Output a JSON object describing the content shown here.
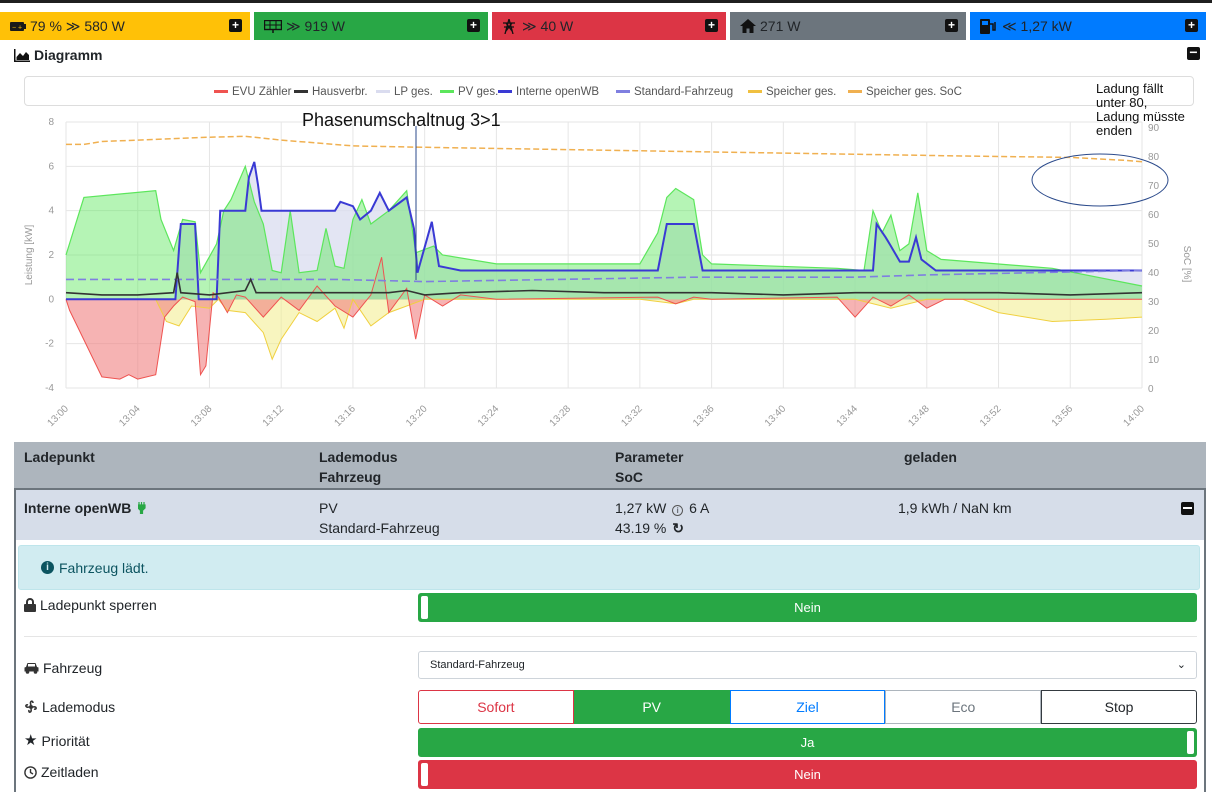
{
  "status": {
    "battery": {
      "icon": "battery-icon",
      "text": "79 % ≫ 580 W",
      "color": "#ffc107"
    },
    "pv": {
      "icon": "solar-panel-icon",
      "text": "≫ 919 W",
      "color": "#28a745"
    },
    "grid": {
      "icon": "grid-tower-icon",
      "text": "≫ 40 W",
      "color": "#dc3545"
    },
    "house": {
      "icon": "home-icon",
      "text": "271 W",
      "color": "#6c757d"
    },
    "charge": {
      "icon": "charging-station-icon",
      "text": "≪ 1,27 kW",
      "color": "#007bff"
    }
  },
  "diagram": {
    "title": "Diagramm"
  },
  "chart_data": {
    "type": "line",
    "legend": [
      "EVU Zähler",
      "Hausverbr.",
      "LP ges.",
      "PV ges.",
      "Interne openWB",
      "Standard-Fahrzeug",
      "Speicher ges.",
      "Speicher ges. SoC"
    ],
    "colors": {
      "EVU Zähler": "#ef5350",
      "Hausverbr.": "#333333",
      "LP ges.": "#dadcef",
      "PV ges.": "#5ce65c",
      "Interne openWB": "#3a3ad4",
      "Standard-Fahrzeug": "#7f7fe0",
      "Speicher ges.": "#f0c040",
      "Speicher ges. SoC": "#f0b050"
    },
    "x_ticks": [
      "13:00",
      "13:04",
      "13:08",
      "13:12",
      "13:16",
      "13:20",
      "13:24",
      "13:28",
      "13:32",
      "13:36",
      "13:40",
      "13:44",
      "13:48",
      "13:52",
      "13:56",
      "14:00"
    ],
    "ylabel": "Leistung [kW]",
    "y2label": "SoC [%]",
    "ylim": [
      -4,
      8
    ],
    "y_ticks": [
      -4,
      -2,
      0,
      2,
      4,
      6,
      8
    ],
    "y2lim": [
      0,
      100
    ],
    "y2_ticks": [
      0,
      10,
      20,
      30,
      40,
      50,
      60,
      70,
      80,
      90
    ],
    "grid": true,
    "annotation_phase": "Phasenumschaltnug 3>1",
    "annotation_note": [
      "Ladung fällt",
      "unter 80,",
      "Ladung müsste",
      "enden"
    ],
    "series": {
      "Interne openWB": [
        [
          0,
          0
        ],
        [
          6.1,
          0
        ],
        [
          6.4,
          3.4
        ],
        [
          7.2,
          3.4
        ],
        [
          7.4,
          0
        ],
        [
          8.4,
          0
        ],
        [
          8.6,
          4
        ],
        [
          10,
          4
        ],
        [
          10.2,
          5.5
        ],
        [
          10.5,
          6.2
        ],
        [
          10.7,
          5.2
        ],
        [
          10.9,
          4
        ],
        [
          15,
          4
        ],
        [
          15.3,
          4.4
        ],
        [
          16,
          4.2
        ],
        [
          16.4,
          3.6
        ],
        [
          17,
          4
        ],
        [
          17.5,
          4.8
        ],
        [
          18,
          4
        ],
        [
          19,
          4.6
        ],
        [
          19.4,
          3.2
        ],
        [
          19.6,
          1.2
        ],
        [
          20.4,
          3.5
        ],
        [
          20.8,
          1.5
        ],
        [
          21.4,
          1.4
        ],
        [
          22,
          1.3
        ],
        [
          33,
          1.3
        ],
        [
          33.5,
          3.4
        ],
        [
          35,
          3.4
        ],
        [
          35.5,
          1.3
        ],
        [
          45,
          1.3
        ],
        [
          45.2,
          3.4
        ],
        [
          45.7,
          2.8
        ],
        [
          46,
          2.4
        ],
        [
          46.5,
          1.7
        ],
        [
          47,
          1.7
        ],
        [
          47.4,
          2.8
        ],
        [
          47.7,
          1.8
        ],
        [
          48.5,
          1.3
        ],
        [
          60,
          1.3
        ]
      ],
      "Standard-Fahrzeug": [
        [
          0,
          0.9
        ],
        [
          15,
          0.9
        ],
        [
          20,
          0.8
        ],
        [
          35,
          1.0
        ],
        [
          44,
          1.0
        ],
        [
          48,
          1.1
        ],
        [
          60,
          1.3
        ]
      ],
      "PV ges.": [
        [
          0,
          2
        ],
        [
          1,
          4.6
        ],
        [
          5,
          4.9
        ],
        [
          5.3,
          3.6
        ],
        [
          6,
          2.2
        ],
        [
          6.5,
          3.6
        ],
        [
          7.2,
          3.5
        ],
        [
          7.5,
          1.2
        ],
        [
          8.4,
          2.5
        ],
        [
          8.8,
          4
        ],
        [
          9.2,
          4.5
        ],
        [
          10,
          6
        ],
        [
          10.5,
          4.4
        ],
        [
          11,
          3.4
        ],
        [
          11.5,
          1.3
        ],
        [
          12,
          1.2
        ],
        [
          12.5,
          4
        ],
        [
          13,
          1.2
        ],
        [
          14,
          1.3
        ],
        [
          14.5,
          3.2
        ],
        [
          15,
          1.5
        ],
        [
          15.5,
          1.4
        ],
        [
          16,
          3.6
        ],
        [
          16.5,
          4.5
        ],
        [
          17,
          3.4
        ],
        [
          18,
          4
        ],
        [
          19,
          4.9
        ],
        [
          19.5,
          2.1
        ],
        [
          20.5,
          2.4
        ],
        [
          21,
          2
        ],
        [
          24,
          1.6
        ],
        [
          32,
          1.6
        ],
        [
          33,
          3
        ],
        [
          33.5,
          4.6
        ],
        [
          34,
          5
        ],
        [
          35,
          4.5
        ],
        [
          35.5,
          2
        ],
        [
          36,
          1.6
        ],
        [
          43,
          1.4
        ],
        [
          44.5,
          1.3
        ],
        [
          45,
          4
        ],
        [
          45.5,
          3
        ],
        [
          46,
          3.8
        ],
        [
          46.5,
          2.2
        ],
        [
          47,
          2.5
        ],
        [
          47.5,
          4.8
        ],
        [
          48,
          2.2
        ],
        [
          48.8,
          1.8
        ],
        [
          55,
          1.4
        ],
        [
          60,
          0.6
        ]
      ],
      "EVU Zähler": [
        [
          0,
          0
        ],
        [
          0.2,
          -0.5
        ],
        [
          2,
          -3.5
        ],
        [
          3,
          -3.6
        ],
        [
          3.5,
          -3.4
        ],
        [
          4,
          -3.6
        ],
        [
          4.5,
          -3.5
        ],
        [
          5,
          -3.4
        ],
        [
          5.5,
          -0.8
        ],
        [
          6,
          -0.3
        ],
        [
          6.5,
          0.1
        ],
        [
          7.2,
          -0.1
        ],
        [
          7.5,
          -3.4
        ],
        [
          7.8,
          -3
        ],
        [
          8.2,
          0.3
        ],
        [
          8.5,
          0.1
        ],
        [
          9,
          -0.6
        ],
        [
          9.5,
          0.2
        ],
        [
          10,
          0.1
        ],
        [
          11,
          -0.8
        ],
        [
          12,
          0.1
        ],
        [
          13,
          -0.5
        ],
        [
          14,
          0.6
        ],
        [
          15,
          -0.3
        ],
        [
          16,
          -0.8
        ],
        [
          17,
          0.2
        ],
        [
          17.6,
          1.9
        ],
        [
          18,
          -0.6
        ],
        [
          19,
          0.5
        ],
        [
          19.5,
          -1.8
        ],
        [
          20,
          0.2
        ],
        [
          21,
          -0.3
        ],
        [
          22,
          0.2
        ],
        [
          24,
          0
        ],
        [
          33,
          0.1
        ],
        [
          34,
          -0.2
        ],
        [
          35,
          0.1
        ],
        [
          36,
          0
        ],
        [
          43,
          0.1
        ],
        [
          44,
          -0.8
        ],
        [
          45,
          0.1
        ],
        [
          46,
          -0.3
        ],
        [
          47,
          0.2
        ],
        [
          48,
          -0.4
        ],
        [
          49,
          0
        ],
        [
          60,
          0
        ]
      ],
      "Speicher ges.": [
        [
          0,
          0
        ],
        [
          5,
          0
        ],
        [
          5.6,
          -1
        ],
        [
          6.3,
          -1.2
        ],
        [
          7,
          -0.3
        ],
        [
          8,
          -0.4
        ],
        [
          8.5,
          0
        ],
        [
          9,
          -0.5
        ],
        [
          10,
          -0.6
        ],
        [
          11,
          -1.5
        ],
        [
          11.5,
          -2.7
        ],
        [
          12,
          -1.8
        ],
        [
          13,
          -0.6
        ],
        [
          14,
          -1
        ],
        [
          15,
          -0.4
        ],
        [
          15.5,
          -1.3
        ],
        [
          16,
          0
        ],
        [
          17,
          -1.2
        ],
        [
          18,
          -0.6
        ],
        [
          19,
          -0.3
        ],
        [
          20,
          0
        ],
        [
          22,
          0
        ],
        [
          30,
          0
        ],
        [
          32,
          0
        ],
        [
          34,
          -0.2
        ],
        [
          35,
          0
        ],
        [
          44,
          0
        ],
        [
          46,
          -0.4
        ],
        [
          48,
          0
        ],
        [
          50,
          0
        ],
        [
          52,
          -0.6
        ],
        [
          55,
          -1
        ],
        [
          58,
          -0.9
        ],
        [
          60,
          -0.8
        ]
      ],
      "Hausverbr.": [
        [
          0,
          0.3
        ],
        [
          2,
          0.2
        ],
        [
          4,
          0.2
        ],
        [
          6,
          0.3
        ],
        [
          6.2,
          1.2
        ],
        [
          6.4,
          0.3
        ],
        [
          8,
          0.2
        ],
        [
          10,
          0.4
        ],
        [
          10.3,
          0.9
        ],
        [
          10.6,
          0.3
        ],
        [
          14,
          0.3
        ],
        [
          16,
          0.3
        ],
        [
          18,
          0.3
        ],
        [
          19,
          0.4
        ],
        [
          20,
          0.2
        ],
        [
          22,
          0.3
        ],
        [
          26,
          0.4
        ],
        [
          30,
          0.3
        ],
        [
          34,
          0.3
        ],
        [
          36,
          0.3
        ],
        [
          40,
          0.2
        ],
        [
          44,
          0.3
        ],
        [
          48,
          0.3
        ],
        [
          52,
          0.3
        ],
        [
          56,
          0.2
        ],
        [
          60,
          0.3
        ]
      ],
      "Speicher ges. SoC": [
        [
          0,
          84
        ],
        [
          1,
          84
        ],
        [
          2,
          85
        ],
        [
          4,
          85.5
        ],
        [
          6,
          86
        ],
        [
          8,
          86.5
        ],
        [
          10,
          86.8
        ],
        [
          12,
          85.5
        ],
        [
          14,
          84.5
        ],
        [
          16,
          83.5
        ],
        [
          20,
          83
        ],
        [
          30,
          82
        ],
        [
          40,
          81
        ],
        [
          50,
          80
        ],
        [
          56,
          79.5
        ],
        [
          59,
          78.5
        ],
        [
          60,
          78
        ]
      ]
    }
  },
  "table": {
    "headers": {
      "ladepunkt": "Ladepunkt",
      "lademodus": "Lademodus",
      "fahrzeug": "Fahrzeug",
      "parameter": "Parameter",
      "soc": "SoC",
      "geladen": "geladen"
    },
    "row": {
      "name": "Interne openWB",
      "mode": "PV",
      "vehicle": "Standard-Fahrzeug",
      "power": "1,27 kW",
      "current": "6 A",
      "soc": "43.19 %",
      "charged": "1,9 kWh / NaN km"
    }
  },
  "details": {
    "alert": "Fahrzeug lädt.",
    "lock_label": "Ladepunkt sperren",
    "lock_value": "Nein",
    "vehicle_label": "Fahrzeug",
    "vehicle_value": "Standard-Fahrzeug",
    "mode_label": "Lademodus",
    "modes": [
      "Sofort",
      "PV",
      "Ziel",
      "Eco",
      "Stop"
    ],
    "mode_selected": "PV",
    "priority_label": "Priorität",
    "priority_value": "Ja",
    "timed_label": "Zeitladen",
    "timed_value": "Nein"
  }
}
